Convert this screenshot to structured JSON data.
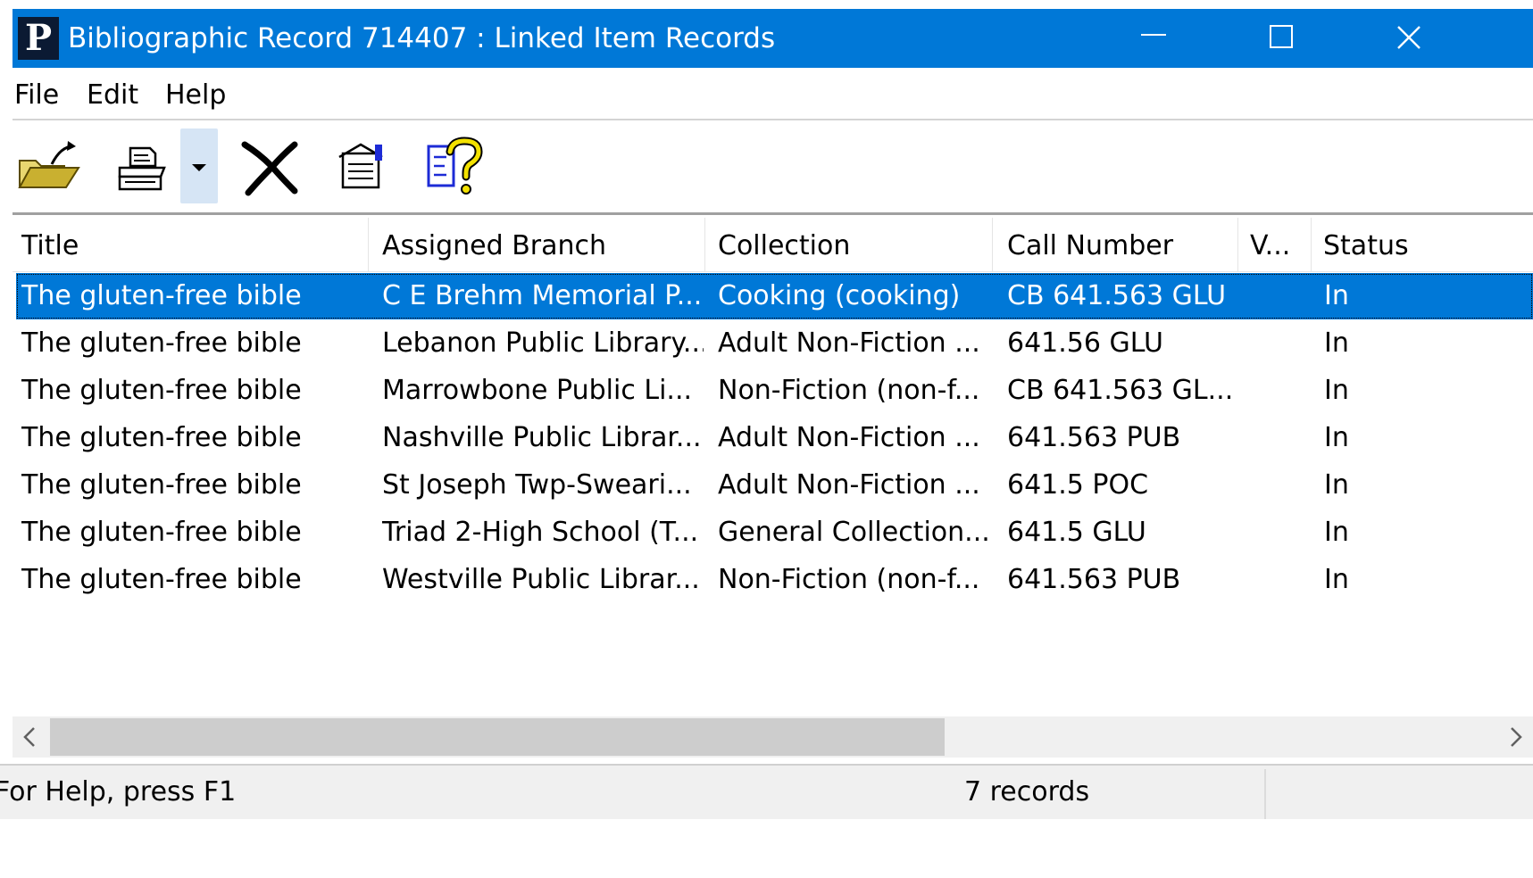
{
  "window": {
    "app_icon_letter": "P",
    "title": "Bibliographic Record 714407 : Linked Item Records",
    "accent_color": "#0078d7"
  },
  "menu": {
    "items": [
      "File",
      "Edit",
      "Help"
    ]
  },
  "toolbar": {
    "buttons": [
      "open-folder-icon",
      "print-icon",
      "dropdown-arrow-icon",
      "delete-x-icon",
      "properties-icon",
      "help-question-icon"
    ]
  },
  "table": {
    "columns": [
      "Title",
      "Assigned Branch",
      "Collection",
      "Call Number",
      "V...",
      "Status"
    ],
    "selected_row": 0,
    "rows": [
      [
        "The gluten-free bible",
        "C E Brehm Memorial P...",
        "Cooking (cooking)",
        "CB 641.563 GLU",
        "",
        "In"
      ],
      [
        "The gluten-free bible",
        "Lebanon Public Library...",
        "Adult Non-Fiction ...",
        "641.56 GLU",
        "",
        "In"
      ],
      [
        "The gluten-free bible",
        "Marrowbone Public Li...",
        "Non-Fiction (non-f...",
        "CB 641.563 GL...",
        "",
        "In"
      ],
      [
        "The gluten-free bible",
        "Nashville Public Librar...",
        "Adult Non-Fiction ...",
        "641.563 PUB",
        "",
        "In"
      ],
      [
        "The gluten-free bible",
        "St Joseph Twp-Sweari...",
        "Adult Non-Fiction ...",
        "641.5 POC",
        "",
        "In"
      ],
      [
        "The gluten-free bible",
        "Triad 2-High School (T...",
        "General Collection...",
        "641.5 GLU",
        "",
        "In"
      ],
      [
        "The gluten-free bible",
        "Westville Public Librar...",
        "Non-Fiction (non-f...",
        "641.563 PUB",
        "",
        "In"
      ]
    ]
  },
  "status": {
    "help_text": "For Help, press F1",
    "record_count": "7 records"
  }
}
